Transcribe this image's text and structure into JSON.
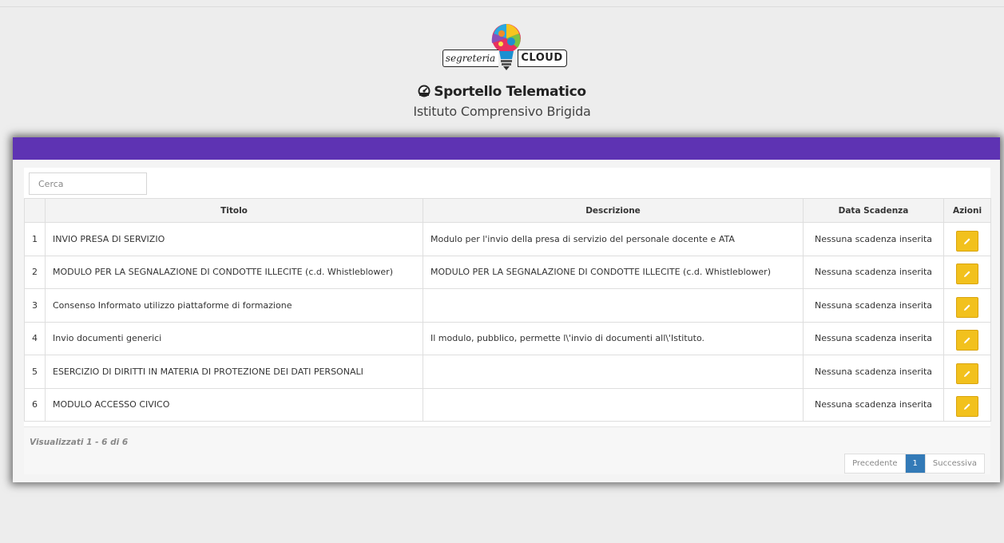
{
  "header": {
    "logo_script": "segreteria",
    "logo_cloud": "CLOUD",
    "title": "Sportello Telematico",
    "subtitle": "Istituto Comprensivo Brigida"
  },
  "search": {
    "placeholder": "Cerca"
  },
  "table": {
    "columns": {
      "num": "",
      "titolo": "Titolo",
      "descrizione": "Descrizione",
      "scadenza": "Data Scadenza",
      "azioni": "Azioni"
    },
    "rows": [
      {
        "num": "1",
        "titolo": "INVIO PRESA DI SERVIZIO",
        "descrizione": "Modulo per l'invio della presa di servizio del personale docente e ATA",
        "scadenza": "Nessuna scadenza inserita"
      },
      {
        "num": "2",
        "titolo": "MODULO PER LA SEGNALAZIONE DI CONDOTTE ILLECITE (c.d. Whistleblower)",
        "descrizione": "MODULO PER LA SEGNALAZIONE DI CONDOTTE ILLECITE (c.d. Whistleblower)",
        "scadenza": "Nessuna scadenza inserita"
      },
      {
        "num": "3",
        "titolo": "Consenso Informato utilizzo piattaforme di formazione",
        "descrizione": "",
        "scadenza": "Nessuna scadenza inserita"
      },
      {
        "num": "4",
        "titolo": "Invio documenti generici",
        "descrizione": "Il modulo, pubblico, permette l\\'invio di documenti all\\'Istituto.",
        "scadenza": "Nessuna scadenza inserita"
      },
      {
        "num": "5",
        "titolo": "ESERCIZIO DI DIRITTI IN MATERIA DI PROTEZIONE DEI DATI PERSONALI",
        "descrizione": "",
        "scadenza": "Nessuna scadenza inserita"
      },
      {
        "num": "6",
        "titolo": "MODULO ACCESSO CIVICO",
        "descrizione": "",
        "scadenza": "Nessuna scadenza inserita"
      }
    ]
  },
  "footer": {
    "showing": "Visualizzati 1 - 6 di 6",
    "prev": "Precedente",
    "current": "1",
    "next": "Successiva"
  },
  "colors": {
    "accent": "#5e33b3",
    "edit_button": "#f2c11d",
    "page_active": "#337ab7"
  },
  "icons": {
    "title_icon": "dashboard-gauge-icon",
    "edit": "pencil-icon",
    "logo": "lightbulb-icon"
  }
}
